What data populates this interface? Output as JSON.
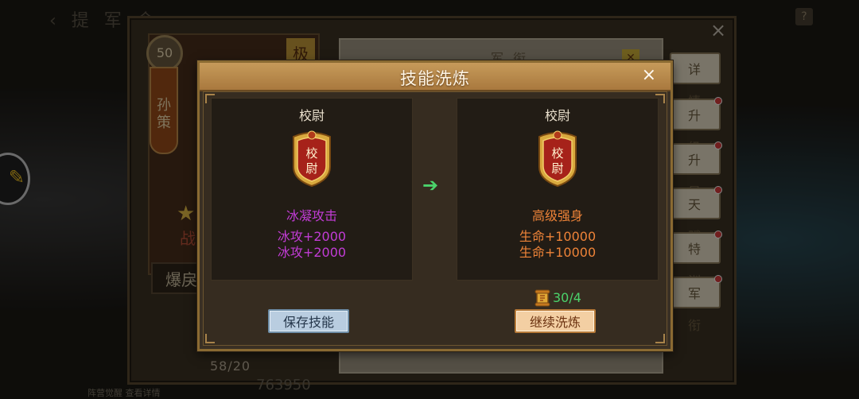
{
  "modal": {
    "title": "技能洗炼",
    "close_glyph": "×",
    "current_skill": {
      "rank": "校尉",
      "emblem_text_top": "校",
      "emblem_text_bottom": "尉",
      "name": "冰凝攻击",
      "attributes": [
        "冰攻+2000",
        "冰攻+2000"
      ]
    },
    "new_skill": {
      "rank": "校尉",
      "emblem_text_top": "校",
      "emblem_text_bottom": "尉",
      "name": "高级强身",
      "attributes": [
        "生命+10000",
        "生命+10000"
      ]
    },
    "arrow_glyph": "➔",
    "cost": {
      "icon": "scroll-item-icon",
      "text": "30/4"
    },
    "save_button": "保存技能",
    "continue_button": "继续洗炼",
    "colors": {
      "current_skill_text": "#c23cd6",
      "new_skill_text": "#ee8338",
      "arrow": "#4bd36b",
      "cost_text": "#4bd36b"
    }
  },
  "background": {
    "back_title": "‹ 提 军 令",
    "help_glyph": "?",
    "close_glyph": "×",
    "hero": {
      "level": "50",
      "name": "孙策",
      "tag": "极",
      "star_glyph": "★",
      "zhan": "战",
      "trait": "爆戾",
      "count": "58/20",
      "power": "763950"
    },
    "right_panel_title": "军衔",
    "side_buttons": [
      "详情",
      "升级",
      "升星",
      "天赋",
      "特训",
      "军衔"
    ],
    "bottom_labels": "阵营觉醒   查看详情"
  }
}
